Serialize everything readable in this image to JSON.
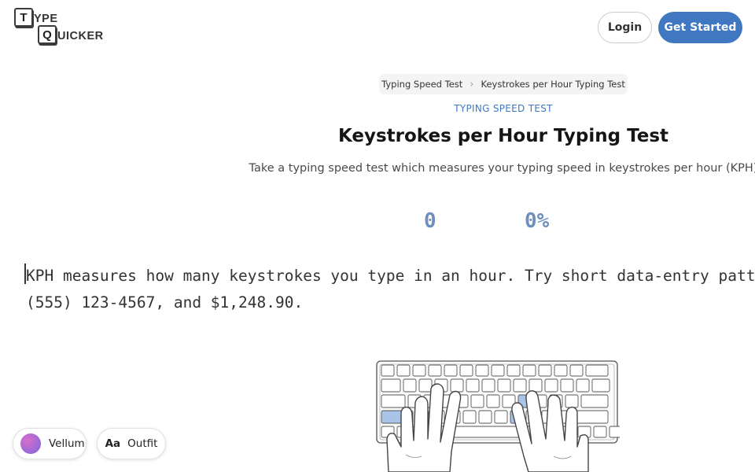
{
  "logo": {
    "key1": "T",
    "text1": "YPE",
    "key2": "Q",
    "text2": "UICKER"
  },
  "header": {
    "login_label": "Login",
    "get_started_label": "Get Started"
  },
  "breadcrumb": {
    "items": [
      "Typing Speed Test",
      "Keystrokes per Hour Typing Test"
    ],
    "separator": "›"
  },
  "hero": {
    "eyebrow": "TYPING SPEED TEST",
    "title": "Keystrokes per Hour Typing Test",
    "subtitle": "Take a typing speed test which measures your typing speed in keystrokes per hour (KPH)"
  },
  "stats": {
    "count": "0",
    "accuracy": "0%"
  },
  "typing": {
    "line1": "KPH measures how many keystrokes you type in an hour. Try short data-entry patterns:",
    "line2": "(555) 123-4567, and $1,248.90."
  },
  "settings": {
    "theme_label": "Vellum",
    "font_icon": "Aa",
    "font_label": "Outfit"
  },
  "icons": [
    "chevron-right-icon",
    "theme-swatch-icon",
    "font-icon",
    "keyboard-hands-illustration"
  ],
  "colors": {
    "accent": "#3f78c0",
    "stat": "#6f8fbf",
    "key_highlight": "#a9c4e6"
  }
}
